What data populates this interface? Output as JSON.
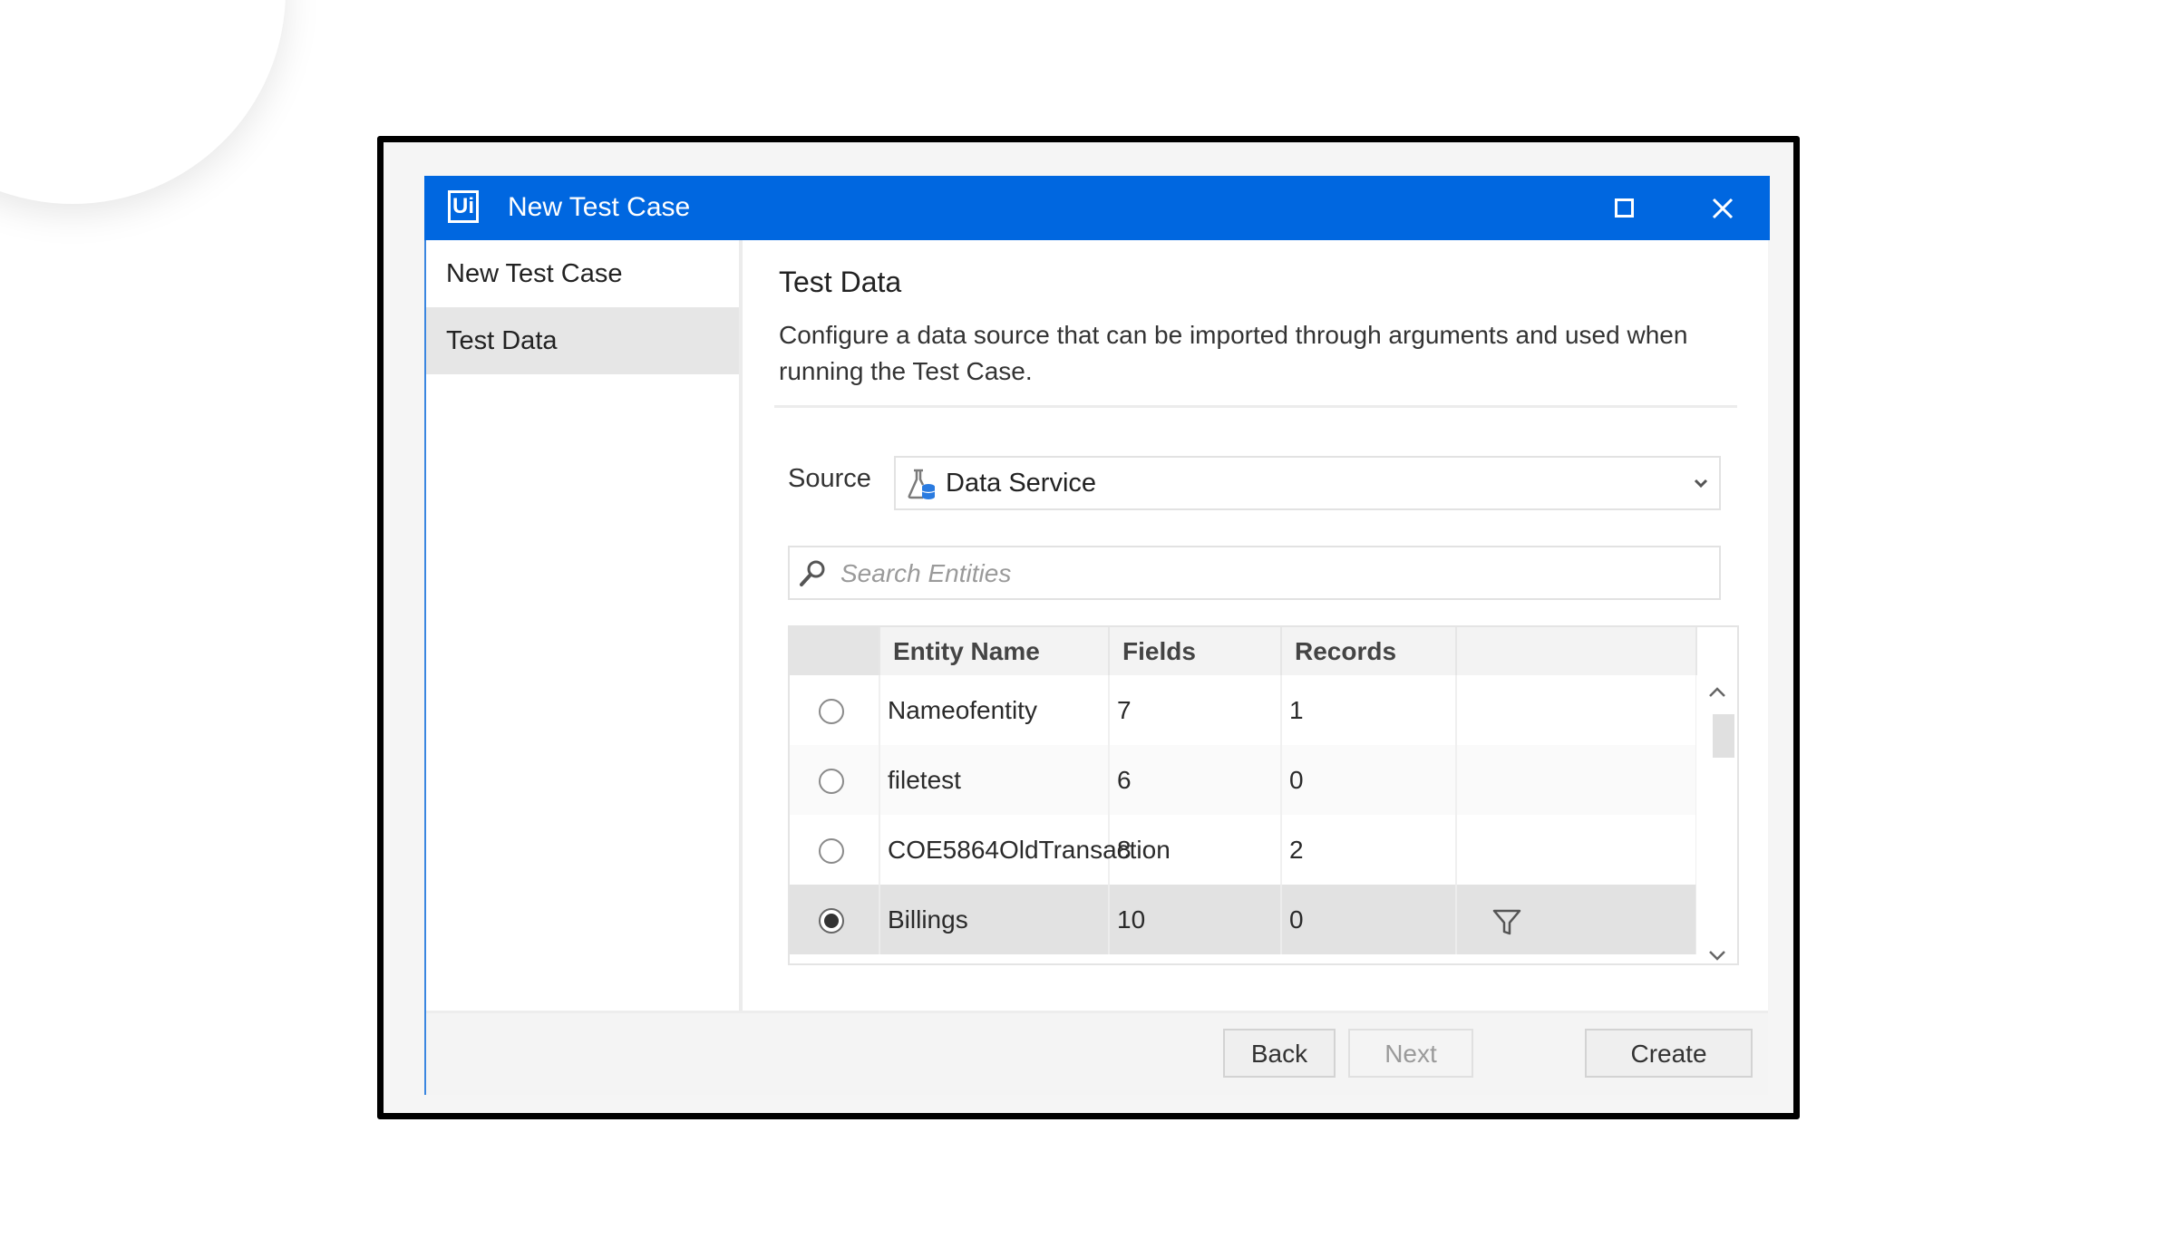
{
  "brand": {
    "logo_icon": "brand-a-arrow-logo"
  },
  "dialog": {
    "title": "New Test Case",
    "app_icon_text": "Ui",
    "window_controls": [
      "maximize",
      "close"
    ]
  },
  "sidebar": {
    "items": [
      {
        "label": "New Test Case",
        "active": false
      },
      {
        "label": "Test Data",
        "active": true
      }
    ]
  },
  "content": {
    "heading": "Test Data",
    "description": "Configure a data source that can be imported through arguments and used when running the Test Case.",
    "source": {
      "label": "Source",
      "selected": "Data Service",
      "icon": "flask-database-icon"
    },
    "search": {
      "placeholder": "Search Entities",
      "value": ""
    },
    "table": {
      "columns": [
        "",
        "Entity Name",
        "Fields",
        "Records",
        ""
      ],
      "rows": [
        {
          "name": "Nameofentity",
          "fields": "7",
          "records": "1",
          "selected": false
        },
        {
          "name": "filetest",
          "fields": "6",
          "records": "0",
          "selected": false
        },
        {
          "name": "COE5864OldTransaction",
          "fields": "8",
          "records": "2",
          "selected": false
        },
        {
          "name": "Billings",
          "fields": "10",
          "records": "0",
          "selected": true
        }
      ]
    }
  },
  "footer": {
    "back_label": "Back",
    "next_label": "Next",
    "create_label": "Create",
    "next_disabled": true
  },
  "colors": {
    "titlebar": "#0067e0",
    "accent_border": "#3a86e0",
    "selected_row": "#e2e2e2",
    "sidebar_active": "#e6e6e6"
  }
}
